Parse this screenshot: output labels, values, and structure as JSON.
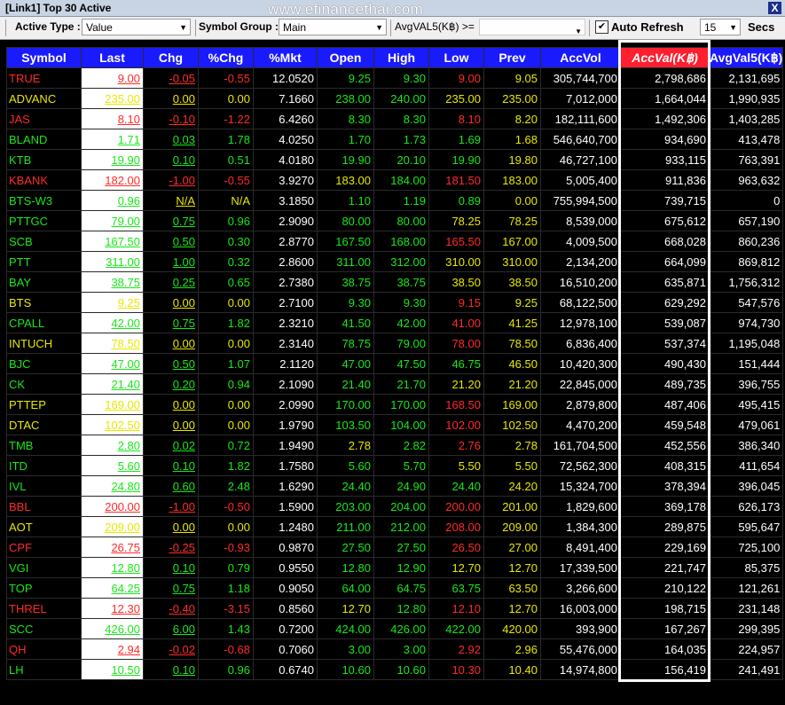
{
  "window": {
    "title": "[Link1] Top 30 Active",
    "watermark": "www.efinancethai.com",
    "close_label": "X"
  },
  "toolbar": {
    "active_type_label": "Active Type :",
    "active_type_value": "Value",
    "symbol_group_label": "Symbol Group :",
    "symbol_group_value": "Main",
    "avg_filter_label": "AvgVAL5(K฿) >=",
    "auto_refresh_label": "Auto Refresh",
    "auto_refresh_checked": true,
    "refresh_interval": "15",
    "secs_label": "Secs"
  },
  "columns": [
    "Symbol",
    "Last",
    "Chg",
    "%Chg",
    "%Mkt",
    "Open",
    "High",
    "Low",
    "Prev",
    "AccVol",
    "AccVal(K฿)",
    "AvgVal5(K฿)"
  ],
  "sorted_column": "AccVal(K฿)",
  "colors": {
    "up": "#18e818",
    "down": "#ff2a2a",
    "neutral": "#e8e800",
    "header_bg": "#1a1aff",
    "sorted_header_bg": "#ff1f2f"
  },
  "rows": [
    {
      "symbol": "TRUE",
      "last": "9.00",
      "chg": "-0.05",
      "pchg": "-0.55",
      "pmkt": "12.0520",
      "open": "9.25",
      "high": "9.30",
      "low": "9.00",
      "prev": "9.05",
      "accvol": "305,744,700",
      "accval": "2,798,686",
      "avgval5": "2,131,695"
    },
    {
      "symbol": "ADVANC",
      "last": "235.00",
      "chg": "0.00",
      "pchg": "0.00",
      "pmkt": "7.1660",
      "open": "238.00",
      "high": "240.00",
      "low": "235.00",
      "prev": "235.00",
      "accvol": "7,012,000",
      "accval": "1,664,044",
      "avgval5": "1,990,935"
    },
    {
      "symbol": "JAS",
      "last": "8.10",
      "chg": "-0.10",
      "pchg": "-1.22",
      "pmkt": "6.4260",
      "open": "8.30",
      "high": "8.30",
      "low": "8.10",
      "prev": "8.20",
      "accvol": "182,111,600",
      "accval": "1,492,306",
      "avgval5": "1,403,285"
    },
    {
      "symbol": "BLAND",
      "last": "1.71",
      "chg": "0.03",
      "pchg": "1.78",
      "pmkt": "4.0250",
      "open": "1.70",
      "high": "1.73",
      "low": "1.69",
      "prev": "1.68",
      "accvol": "546,640,700",
      "accval": "934,690",
      "avgval5": "413,478"
    },
    {
      "symbol": "KTB",
      "last": "19.90",
      "chg": "0.10",
      "pchg": "0.51",
      "pmkt": "4.0180",
      "open": "19.90",
      "high": "20.10",
      "low": "19.90",
      "prev": "19.80",
      "accvol": "46,727,100",
      "accval": "933,115",
      "avgval5": "763,391"
    },
    {
      "symbol": "KBANK",
      "last": "182.00",
      "chg": "-1.00",
      "pchg": "-0.55",
      "pmkt": "3.9270",
      "open": "183.00",
      "high": "184.00",
      "low": "181.50",
      "prev": "183.00",
      "accvol": "5,005,400",
      "accval": "911,836",
      "avgval5": "963,632"
    },
    {
      "symbol": "BTS-W3",
      "last": "0.96",
      "chg": "N/A",
      "pchg": "N/A",
      "pmkt": "3.1850",
      "open": "1.10",
      "high": "1.19",
      "low": "0.89",
      "prev": "0.00",
      "accvol": "755,994,500",
      "accval": "739,715",
      "avgval5": "0"
    },
    {
      "symbol": "PTTGC",
      "last": "79.00",
      "chg": "0.75",
      "pchg": "0.96",
      "pmkt": "2.9090",
      "open": "80.00",
      "high": "80.00",
      "low": "78.25",
      "prev": "78.25",
      "accvol": "8,539,000",
      "accval": "675,612",
      "avgval5": "657,190"
    },
    {
      "symbol": "SCB",
      "last": "167.50",
      "chg": "0.50",
      "pchg": "0.30",
      "pmkt": "2.8770",
      "open": "167.50",
      "high": "168.00",
      "low": "165.50",
      "prev": "167.00",
      "accvol": "4,009,500",
      "accval": "668,028",
      "avgval5": "860,236"
    },
    {
      "symbol": "PTT",
      "last": "311.00",
      "chg": "1.00",
      "pchg": "0.32",
      "pmkt": "2.8600",
      "open": "311.00",
      "high": "312.00",
      "low": "310.00",
      "prev": "310.00",
      "accvol": "2,134,200",
      "accval": "664,099",
      "avgval5": "869,812"
    },
    {
      "symbol": "BAY",
      "last": "38.75",
      "chg": "0.25",
      "pchg": "0.65",
      "pmkt": "2.7380",
      "open": "38.75",
      "high": "38.75",
      "low": "38.50",
      "prev": "38.50",
      "accvol": "16,510,200",
      "accval": "635,871",
      "avgval5": "1,756,312"
    },
    {
      "symbol": "BTS",
      "last": "9.25",
      "chg": "0.00",
      "pchg": "0.00",
      "pmkt": "2.7100",
      "open": "9.30",
      "high": "9.30",
      "low": "9.15",
      "prev": "9.25",
      "accvol": "68,122,500",
      "accval": "629,292",
      "avgval5": "547,576"
    },
    {
      "symbol": "CPALL",
      "last": "42.00",
      "chg": "0.75",
      "pchg": "1.82",
      "pmkt": "2.3210",
      "open": "41.50",
      "high": "42.00",
      "low": "41.00",
      "prev": "41.25",
      "accvol": "12,978,100",
      "accval": "539,087",
      "avgval5": "974,730"
    },
    {
      "symbol": "INTUCH",
      "last": "78.50",
      "chg": "0.00",
      "pchg": "0.00",
      "pmkt": "2.3140",
      "open": "78.75",
      "high": "79.00",
      "low": "78.00",
      "prev": "78.50",
      "accvol": "6,836,400",
      "accval": "537,374",
      "avgval5": "1,195,048"
    },
    {
      "symbol": "BJC",
      "last": "47.00",
      "chg": "0.50",
      "pchg": "1.07",
      "pmkt": "2.1120",
      "open": "47.00",
      "high": "47.50",
      "low": "46.75",
      "prev": "46.50",
      "accvol": "10,420,300",
      "accval": "490,430",
      "avgval5": "151,444"
    },
    {
      "symbol": "CK",
      "last": "21.40",
      "chg": "0.20",
      "pchg": "0.94",
      "pmkt": "2.1090",
      "open": "21.40",
      "high": "21.70",
      "low": "21.20",
      "prev": "21.20",
      "accvol": "22,845,000",
      "accval": "489,735",
      "avgval5": "396,755"
    },
    {
      "symbol": "PTTEP",
      "last": "169.00",
      "chg": "0.00",
      "pchg": "0.00",
      "pmkt": "2.0990",
      "open": "170.00",
      "high": "170.00",
      "low": "168.50",
      "prev": "169.00",
      "accvol": "2,879,800",
      "accval": "487,406",
      "avgval5": "495,415"
    },
    {
      "symbol": "DTAC",
      "last": "102.50",
      "chg": "0.00",
      "pchg": "0.00",
      "pmkt": "1.9790",
      "open": "103.50",
      "high": "104.00",
      "low": "102.00",
      "prev": "102.50",
      "accvol": "4,470,200",
      "accval": "459,548",
      "avgval5": "479,061"
    },
    {
      "symbol": "TMB",
      "last": "2.80",
      "chg": "0.02",
      "pchg": "0.72",
      "pmkt": "1.9490",
      "open": "2.78",
      "high": "2.82",
      "low": "2.76",
      "prev": "2.78",
      "accvol": "161,704,500",
      "accval": "452,556",
      "avgval5": "386,340"
    },
    {
      "symbol": "ITD",
      "last": "5.60",
      "chg": "0.10",
      "pchg": "1.82",
      "pmkt": "1.7580",
      "open": "5.60",
      "high": "5.70",
      "low": "5.50",
      "prev": "5.50",
      "accvol": "72,562,300",
      "accval": "408,315",
      "avgval5": "411,654"
    },
    {
      "symbol": "IVL",
      "last": "24.80",
      "chg": "0.60",
      "pchg": "2.48",
      "pmkt": "1.6290",
      "open": "24.40",
      "high": "24.90",
      "low": "24.40",
      "prev": "24.20",
      "accvol": "15,324,700",
      "accval": "378,394",
      "avgval5": "396,045"
    },
    {
      "symbol": "BBL",
      "last": "200.00",
      "chg": "-1.00",
      "pchg": "-0.50",
      "pmkt": "1.5900",
      "open": "203.00",
      "high": "204.00",
      "low": "200.00",
      "prev": "201.00",
      "accvol": "1,829,600",
      "accval": "369,178",
      "avgval5": "626,173"
    },
    {
      "symbol": "AOT",
      "last": "209.00",
      "chg": "0.00",
      "pchg": "0.00",
      "pmkt": "1.2480",
      "open": "211.00",
      "high": "212.00",
      "low": "208.00",
      "prev": "209.00",
      "accvol": "1,384,300",
      "accval": "289,875",
      "avgval5": "595,647"
    },
    {
      "symbol": "CPF",
      "last": "26.75",
      "chg": "-0.25",
      "pchg": "-0.93",
      "pmkt": "0.9870",
      "open": "27.50",
      "high": "27.50",
      "low": "26.50",
      "prev": "27.00",
      "accvol": "8,491,400",
      "accval": "229,169",
      "avgval5": "725,100"
    },
    {
      "symbol": "VGI",
      "last": "12.80",
      "chg": "0.10",
      "pchg": "0.79",
      "pmkt": "0.9550",
      "open": "12.80",
      "high": "12.90",
      "low": "12.70",
      "prev": "12.70",
      "accvol": "17,339,500",
      "accval": "221,747",
      "avgval5": "85,375"
    },
    {
      "symbol": "TOP",
      "last": "64.25",
      "chg": "0.75",
      "pchg": "1.18",
      "pmkt": "0.9050",
      "open": "64.00",
      "high": "64.75",
      "low": "63.75",
      "prev": "63.50",
      "accvol": "3,266,600",
      "accval": "210,122",
      "avgval5": "121,261"
    },
    {
      "symbol": "THREL",
      "last": "12.30",
      "chg": "-0.40",
      "pchg": "-3.15",
      "pmkt": "0.8560",
      "open": "12.70",
      "high": "12.80",
      "low": "12.10",
      "prev": "12.70",
      "accvol": "16,003,000",
      "accval": "198,715",
      "avgval5": "231,148"
    },
    {
      "symbol": "SCC",
      "last": "426.00",
      "chg": "6.00",
      "pchg": "1.43",
      "pmkt": "0.7200",
      "open": "424.00",
      "high": "426.00",
      "low": "422.00",
      "prev": "420.00",
      "accvol": "393,900",
      "accval": "167,267",
      "avgval5": "299,395"
    },
    {
      "symbol": "QH",
      "last": "2.94",
      "chg": "-0.02",
      "pchg": "-0.68",
      "pmkt": "0.7060",
      "open": "3.00",
      "high": "3.00",
      "low": "2.92",
      "prev": "2.96",
      "accvol": "55,476,000",
      "accval": "164,035",
      "avgval5": "224,957"
    },
    {
      "symbol": "LH",
      "last": "10.50",
      "chg": "0.10",
      "pchg": "0.96",
      "pmkt": "0.6740",
      "open": "10.60",
      "high": "10.60",
      "low": "10.30",
      "prev": "10.40",
      "accvol": "14,974,800",
      "accval": "156,419",
      "avgval5": "241,491"
    }
  ]
}
